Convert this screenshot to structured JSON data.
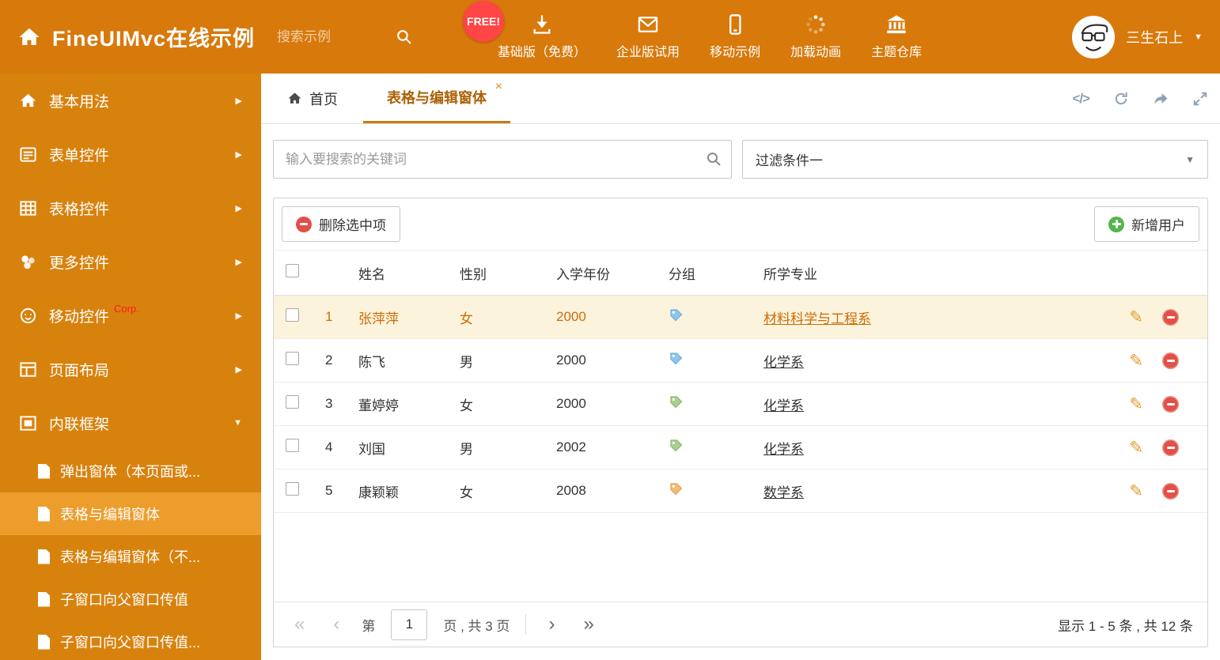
{
  "colors": {
    "header_bg": "#D8790B",
    "sidebar_bg": "#D8820E",
    "sidebar_active_bg": "#EC9D2B",
    "accent": "#C97A0B",
    "selected_row_bg": "#FCF3DC",
    "selected_row_text": "#CB6D07",
    "free_badge_bg": "#FF4545",
    "delete_red": "#E25048",
    "add_green": "#52B64A"
  },
  "header": {
    "brand": "FineUIMvc在线示例",
    "search_placeholder": "搜索示例",
    "free_badge": "FREE!",
    "nav": [
      {
        "icon": "download-icon",
        "label": "基础版（免费）"
      },
      {
        "icon": "mail-icon",
        "label": "企业版试用"
      },
      {
        "icon": "mobile-icon",
        "label": "移动示例"
      },
      {
        "icon": "spinner-icon",
        "label": "加载动画"
      },
      {
        "icon": "bank-icon",
        "label": "主题仓库"
      }
    ],
    "user_name": "三生石上"
  },
  "sidebar": {
    "items": [
      {
        "label": "基本用法"
      },
      {
        "label": "表单控件"
      },
      {
        "label": "表格控件"
      },
      {
        "label": "更多控件"
      },
      {
        "label": "移动控件",
        "badge": "Corp."
      },
      {
        "label": "页面布局"
      },
      {
        "label": "内联框架"
      }
    ],
    "subitems": [
      {
        "label": "弹出窗体（本页面或..."
      },
      {
        "label": "表格与编辑窗体"
      },
      {
        "label": "表格与编辑窗体（不..."
      },
      {
        "label": "子窗口向父窗口传值"
      },
      {
        "label": "子窗口向父窗口传值..."
      }
    ]
  },
  "tabs": {
    "home": "首页",
    "active": "表格与编辑窗体",
    "close": "×",
    "code_icon": "</>"
  },
  "filters": {
    "search_placeholder": "输入要搜索的关键词",
    "filter_selected": "过滤条件一"
  },
  "toolbar": {
    "delete": "删除选中项",
    "add": "新增用户"
  },
  "table": {
    "columns": [
      "姓名",
      "性别",
      "入学年份",
      "分组",
      "所学专业"
    ],
    "rows": [
      {
        "num": "1",
        "name": "张萍萍",
        "gender": "女",
        "year": "2000",
        "tag": "blue",
        "tag_class": "tag tag-blue",
        "major": "材料科学与工程系",
        "selected": true
      },
      {
        "num": "2",
        "name": "陈飞",
        "gender": "男",
        "year": "2000",
        "tag": "blue",
        "tag_class": "tag tag-blue",
        "major": "化学系",
        "selected": false
      },
      {
        "num": "3",
        "name": "董婷婷",
        "gender": "女",
        "year": "2000",
        "tag": "green",
        "tag_class": "tag tag-green",
        "major": "化学系",
        "selected": false
      },
      {
        "num": "4",
        "name": "刘国",
        "gender": "男",
        "year": "2002",
        "tag": "green",
        "tag_class": "tag tag-green",
        "major": "化学系",
        "selected": false
      },
      {
        "num": "5",
        "name": "康颖颖",
        "gender": "女",
        "year": "2008",
        "tag": "orange",
        "tag_class": "tag tag-orange",
        "major": "数学系",
        "selected": false
      }
    ]
  },
  "pagination": {
    "first": "«",
    "prev": "‹",
    "label_pre": "第",
    "page": "1",
    "label_post": "页 , 共 3 页",
    "next": "›",
    "last": "»",
    "summary": "显示 1 - 5 条 , 共 12 条"
  },
  "icons": {
    "pencil": "✎",
    "caret_down": "▼",
    "chevron_right": "▶"
  }
}
